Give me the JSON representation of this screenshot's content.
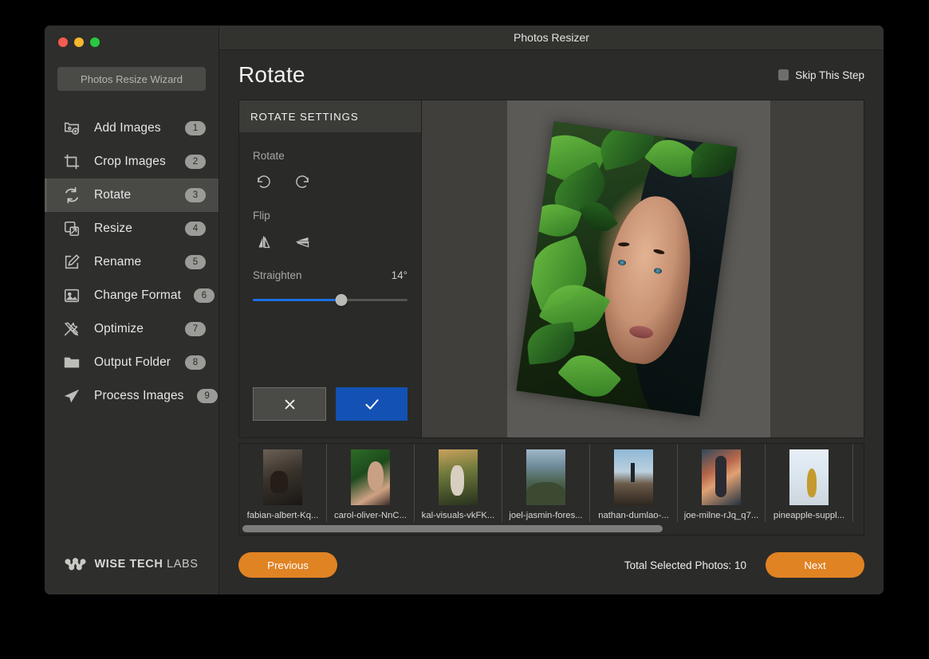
{
  "window": {
    "app_title": "Photos Resizer",
    "wizard_badge": "Photos Resize Wizard"
  },
  "sidebar": {
    "items": [
      {
        "label": "Add Images",
        "badge": "1",
        "icon": "add-images-icon",
        "active": false
      },
      {
        "label": "Crop Images",
        "badge": "2",
        "icon": "crop-icon",
        "active": false
      },
      {
        "label": "Rotate",
        "badge": "3",
        "icon": "rotate-icon",
        "active": true
      },
      {
        "label": "Resize",
        "badge": "4",
        "icon": "resize-icon",
        "active": false
      },
      {
        "label": "Rename",
        "badge": "5",
        "icon": "rename-icon",
        "active": false
      },
      {
        "label": "Change Format",
        "badge": "6",
        "icon": "image-icon",
        "active": false
      },
      {
        "label": "Optimize",
        "badge": "7",
        "icon": "tools-icon",
        "active": false
      },
      {
        "label": "Output Folder",
        "badge": "8",
        "icon": "folder-icon",
        "active": false
      },
      {
        "label": "Process Images",
        "badge": "9",
        "icon": "paper-plane-icon",
        "active": false
      }
    ],
    "brand": {
      "part1": "WISE TECH",
      "part2": "LABS"
    }
  },
  "page": {
    "title": "Rotate",
    "skip_label": "Skip This Step",
    "skip_checked": false
  },
  "settings": {
    "header": "ROTATE SETTINGS",
    "rotate_label": "Rotate",
    "rotate_left_name": "rotate-left",
    "rotate_right_name": "rotate-right",
    "flip_label": "Flip",
    "flip_horizontal_name": "flip-horizontal",
    "flip_vertical_name": "flip-vertical",
    "straighten_label": "Straighten",
    "straighten_value": "14°",
    "straighten_percent": 57,
    "cancel_glyph": "✕",
    "apply_glyph": "✓"
  },
  "thumbnails": [
    {
      "name": "fabian-albert-Kq...",
      "art": "t1"
    },
    {
      "name": "carol-oliver-NnC...",
      "art": "t2"
    },
    {
      "name": "kal-visuals-vkFK...",
      "art": "t3"
    },
    {
      "name": "joel-jasmin-fores...",
      "art": "t4"
    },
    {
      "name": "nathan-dumlao-...",
      "art": "t5"
    },
    {
      "name": "joe-milne-rJq_q7...",
      "art": "t6"
    },
    {
      "name": "pineapple-suppl...",
      "art": "t7"
    }
  ],
  "footer": {
    "previous_label": "Previous",
    "total_label": "Total Selected Photos: 10",
    "next_label": "Next"
  },
  "colors": {
    "accent_orange": "#e08323",
    "accent_blue": "#1351b4",
    "slider_blue": "#1c6fe0",
    "sidebar_bg": "#2e2e2c",
    "panel_bg": "#2a2a28"
  }
}
